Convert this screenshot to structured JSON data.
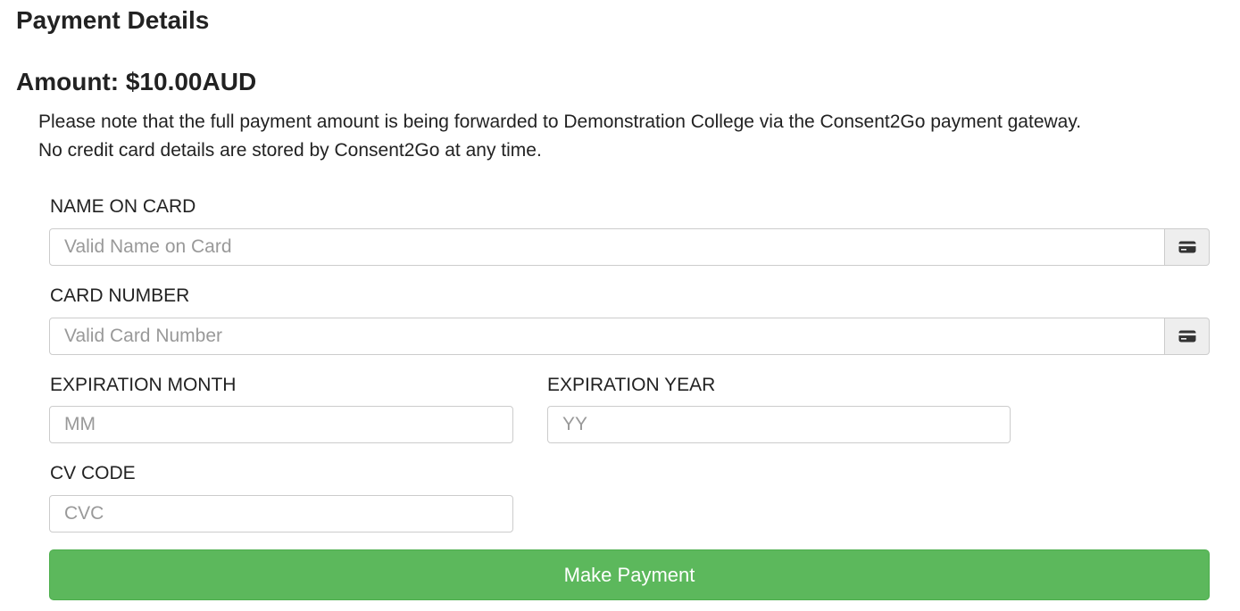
{
  "page": {
    "title": "Payment Details",
    "amount_line": "Amount: $10.00AUD",
    "notice_line1": "Please note that the full payment amount is being forwarded to Demonstration College via the Consent2Go payment gateway.",
    "notice_line2": "No credit card details are stored by Consent2Go at any time."
  },
  "form": {
    "name_on_card": {
      "label": "NAME ON CARD",
      "placeholder": "Valid Name on Card",
      "value": "",
      "icon": "credit-card-icon"
    },
    "card_number": {
      "label": "CARD NUMBER",
      "placeholder": "Valid Card Number",
      "value": "",
      "icon": "credit-card-icon"
    },
    "expiration_month": {
      "label": "EXPIRATION MONTH",
      "placeholder": "MM",
      "value": ""
    },
    "expiration_year": {
      "label": "EXPIRATION YEAR",
      "placeholder": "YY",
      "value": ""
    },
    "cv_code": {
      "label": "CV CODE",
      "placeholder": "CVC",
      "value": ""
    },
    "submit_label": "Make Payment"
  },
  "colors": {
    "button_bg": "#5cb85c",
    "button_border": "#4cae4c",
    "addon_bg": "#eeeeee",
    "input_border": "#cccccc",
    "placeholder": "#999999"
  }
}
